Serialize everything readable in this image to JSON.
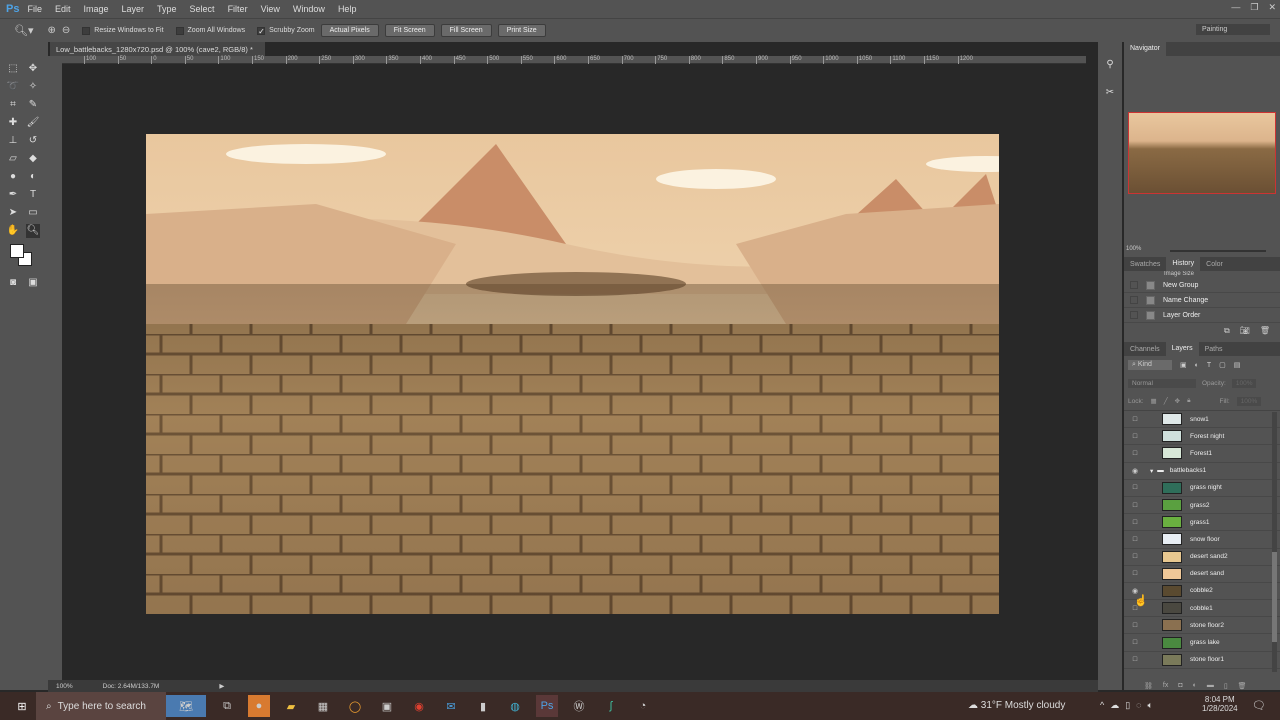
{
  "menubar": {
    "logo": "Ps",
    "items": [
      "File",
      "Edit",
      "Image",
      "Layer",
      "Type",
      "Select",
      "Filter",
      "View",
      "Window",
      "Help"
    ]
  },
  "options": {
    "resize_windows": "Resize Windows to Fit",
    "zoom_all": "Zoom All Windows",
    "scrubby": "Scrubby Zoom",
    "actual_pixels": "Actual Pixels",
    "fit_screen": "Fit Screen",
    "fill_screen": "Fill Screen",
    "print_size": "Print Size",
    "workspace": "Painting"
  },
  "document": {
    "tab": "Low_battlebacks_1280x720.psd @ 100% (cave2, RGB/8) *",
    "ruler": [
      "100",
      "50",
      "0",
      "50",
      "100",
      "150",
      "200",
      "250",
      "300",
      "350",
      "400",
      "450",
      "500",
      "550",
      "600",
      "650",
      "700",
      "750",
      "800",
      "850",
      "900",
      "950",
      "1000",
      "1050",
      "1100",
      "1150",
      "1200"
    ]
  },
  "status": {
    "zoom": "100%",
    "doc": "Doc: 2.64M/133.7M"
  },
  "navigator": {
    "title": "Navigator",
    "zoom": "100%"
  },
  "history": {
    "tabs": [
      "Swatches",
      "History",
      "Color"
    ],
    "items": [
      "Image Size",
      "New Group",
      "Name Change",
      "Layer Order"
    ]
  },
  "layers": {
    "tabs": [
      "Channels",
      "Layers",
      "Paths"
    ],
    "kind": "Kind",
    "blend": "Normal",
    "opacity_label": "Opacity:",
    "opacity": "100%",
    "lock_label": "Lock:",
    "fill_label": "Fill:",
    "fill": "100%",
    "items": [
      {
        "name": "snow1",
        "visible": false,
        "color": "#dfe8e8"
      },
      {
        "name": "Forest night",
        "visible": false,
        "color": "#cfe0dc"
      },
      {
        "name": "Forest1",
        "visible": false,
        "color": "#d8e8d8"
      },
      {
        "name": "battlebacks1",
        "visible": true,
        "group": true
      },
      {
        "name": "grass night",
        "visible": false,
        "color": "#2f6e5a"
      },
      {
        "name": "grass2",
        "visible": false,
        "color": "#5aa040"
      },
      {
        "name": "grass1",
        "visible": false,
        "color": "#6ab040"
      },
      {
        "name": "snow floor",
        "visible": false,
        "color": "#e8eef4"
      },
      {
        "name": "desert sand2",
        "visible": false,
        "color": "#e8c890"
      },
      {
        "name": "desert sand",
        "visible": false,
        "color": "#f0c898"
      },
      {
        "name": "cobble2",
        "visible": true,
        "color": "#5a4a30"
      },
      {
        "name": "cobble1",
        "visible": false,
        "color": "#4a4840"
      },
      {
        "name": "stone floor2",
        "visible": false,
        "color": "#8a7050"
      },
      {
        "name": "grass lake",
        "visible": false,
        "color": "#4a8a40"
      },
      {
        "name": "stone floor1",
        "visible": false,
        "color": "#7a7a5a"
      }
    ]
  },
  "taskbar": {
    "search": "Type here to search",
    "weather": "31°F  Mostly cloudy",
    "time": "8:04 PM",
    "date": "1/28/2024"
  }
}
